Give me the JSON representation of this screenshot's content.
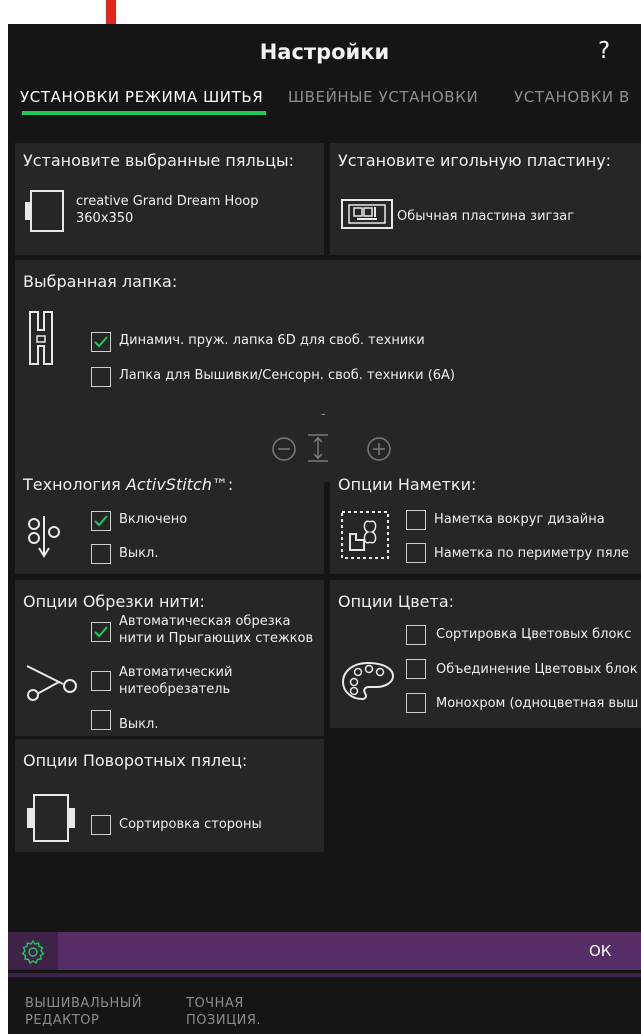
{
  "header": {
    "title": "Настройки",
    "help_label": "?"
  },
  "tabs": [
    {
      "label": "УСТАНОВКИ РЕЖИМА ШИТЬЯ",
      "active": true
    },
    {
      "label": "ШВЕЙНЫЕ УСТАНОВКИ",
      "active": false
    },
    {
      "label": "УСТАНОВКИ В",
      "active": false
    }
  ],
  "hoop": {
    "title": "Установите выбранные пяльцы:",
    "name_line1": "creative Grand Dream Hoop",
    "name_line2": "360x350",
    "icon": "hoop-icon"
  },
  "needle_plate": {
    "title": "Установите игольную пластину:",
    "name": "Обычная пластина зигзаг",
    "icon": "stitch-plate-icon"
  },
  "presser_foot": {
    "title": "Выбранная лапка:",
    "options": [
      {
        "label": "Динамич. пруж. лапка 6D для своб. техники",
        "checked": true
      },
      {
        "label": "Лапка для Вышивки/Сенсорн. своб. техники (6А)",
        "checked": false
      }
    ],
    "height_value": "-",
    "icon": "presser-foot-icon"
  },
  "activstitch": {
    "title_prefix": "Технология ",
    "title_italic": "ActivStitch",
    "title_suffix": "™:",
    "options": [
      {
        "label": "Включено",
        "checked": true
      },
      {
        "label": "Выкл.",
        "checked": false
      }
    ]
  },
  "basting": {
    "title": "Опции Наметки:",
    "options": [
      {
        "label": "Наметка вокруг дизайна",
        "checked": false
      },
      {
        "label": "Наметка по периметру пяле",
        "checked": false
      }
    ]
  },
  "thread_cut": {
    "title": "Опции Обрезки нити:",
    "options": [
      {
        "line1": "Автоматическая  обрезка",
        "line2": "нити и Прыгающих стежков",
        "checked": true
      },
      {
        "line1": "Автоматический",
        "line2": "нитеобрезатель",
        "checked": false
      },
      {
        "line1": "Выкл.",
        "line2": "",
        "checked": false
      }
    ]
  },
  "color": {
    "title": "Опции Цвета:",
    "options": [
      {
        "label": "Сортировка Цветовых блокс",
        "checked": false
      },
      {
        "label": "Объединение Цветовых блок",
        "checked": false
      },
      {
        "label": "Монохром (одноцветная выш",
        "checked": false
      }
    ]
  },
  "rotate_hoop": {
    "title": "Опции Поворотных пялец:",
    "options": [
      {
        "label": "Сортировка стороны",
        "checked": false
      }
    ]
  },
  "footer": {
    "ok_label": "ОК"
  },
  "bottom_nav": [
    {
      "line1": "ВЫШИВАЛЬНЫЙ",
      "line2": "РЕДАКТОР"
    },
    {
      "line1": "ТОЧНАЯ",
      "line2": "ПОЗИЦИЯ."
    }
  ],
  "colors": {
    "accent_green": "#1fc85a",
    "annotation_red": "#e0261d",
    "bar_purple": "#572d66"
  }
}
